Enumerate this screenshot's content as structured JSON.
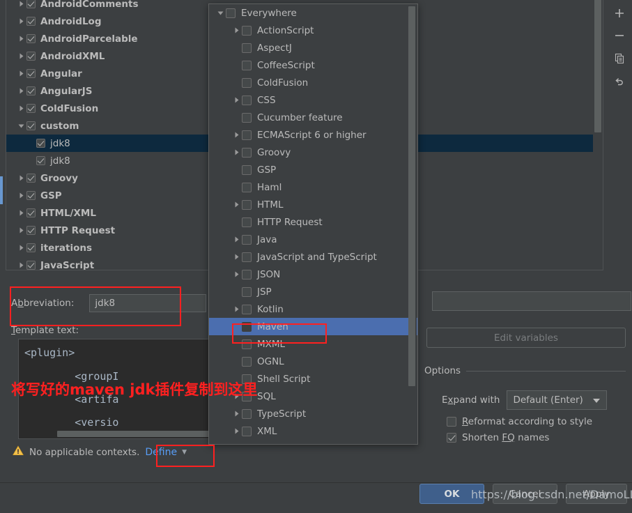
{
  "tree": {
    "scroll_thumb": true,
    "items": [
      {
        "label": "AndroidComments",
        "checked": true,
        "expandable": true,
        "expanded": false,
        "level": 0,
        "selected": false,
        "clipped": true
      },
      {
        "label": "AndroidLog",
        "checked": true,
        "expandable": true,
        "expanded": false,
        "level": 0,
        "selected": false
      },
      {
        "label": "AndroidParcelable",
        "checked": true,
        "expandable": true,
        "expanded": false,
        "level": 0,
        "selected": false
      },
      {
        "label": "AndroidXML",
        "checked": true,
        "expandable": true,
        "expanded": false,
        "level": 0,
        "selected": false
      },
      {
        "label": "Angular",
        "checked": true,
        "expandable": true,
        "expanded": false,
        "level": 0,
        "selected": false
      },
      {
        "label": "AngularJS",
        "checked": true,
        "expandable": true,
        "expanded": false,
        "level": 0,
        "selected": false
      },
      {
        "label": "ColdFusion",
        "checked": true,
        "expandable": true,
        "expanded": false,
        "level": 0,
        "selected": false
      },
      {
        "label": "custom",
        "checked": true,
        "expandable": true,
        "expanded": true,
        "level": 0,
        "selected": false
      },
      {
        "label": "jdk8",
        "checked": true,
        "expandable": false,
        "expanded": false,
        "level": 1,
        "selected": true
      },
      {
        "label": "jdk8",
        "checked": true,
        "expandable": false,
        "expanded": false,
        "level": 1,
        "selected": false
      },
      {
        "label": "Groovy",
        "checked": true,
        "expandable": true,
        "expanded": false,
        "level": 0,
        "selected": false
      },
      {
        "label": "GSP",
        "checked": true,
        "expandable": true,
        "expanded": false,
        "level": 0,
        "selected": false
      },
      {
        "label": "HTML/XML",
        "checked": true,
        "expandable": true,
        "expanded": false,
        "level": 0,
        "selected": false
      },
      {
        "label": "HTTP Request",
        "checked": true,
        "expandable": true,
        "expanded": false,
        "level": 0,
        "selected": false
      },
      {
        "label": "iterations",
        "checked": true,
        "expandable": true,
        "expanded": false,
        "level": 0,
        "selected": false
      },
      {
        "label": "JavaScript",
        "checked": true,
        "expandable": true,
        "expanded": false,
        "level": 0,
        "selected": false
      }
    ]
  },
  "rail": {
    "buttons": [
      {
        "icon": "plus-icon",
        "name": "add-template-button"
      },
      {
        "icon": "minus-icon",
        "name": "remove-template-button"
      },
      {
        "icon": "copy-icon",
        "name": "duplicate-template-button"
      },
      {
        "icon": "undo-icon",
        "name": "restore-defaults-button"
      }
    ]
  },
  "context_popup": {
    "items": [
      {
        "label": "Everywhere",
        "level": 0,
        "expandable": true,
        "expanded": true,
        "checked": false,
        "selected": false
      },
      {
        "label": "ActionScript",
        "level": 1,
        "expandable": true,
        "expanded": false,
        "checked": false,
        "selected": false
      },
      {
        "label": "AspectJ",
        "level": 1,
        "expandable": false,
        "expanded": false,
        "checked": false,
        "selected": false
      },
      {
        "label": "CoffeeScript",
        "level": 1,
        "expandable": false,
        "expanded": false,
        "checked": false,
        "selected": false
      },
      {
        "label": "ColdFusion",
        "level": 1,
        "expandable": false,
        "expanded": false,
        "checked": false,
        "selected": false
      },
      {
        "label": "CSS",
        "level": 1,
        "expandable": true,
        "expanded": false,
        "checked": false,
        "selected": false
      },
      {
        "label": "Cucumber feature",
        "level": 1,
        "expandable": false,
        "expanded": false,
        "checked": false,
        "selected": false
      },
      {
        "label": "ECMAScript 6 or higher",
        "level": 1,
        "expandable": true,
        "expanded": false,
        "checked": false,
        "selected": false
      },
      {
        "label": "Groovy",
        "level": 1,
        "expandable": true,
        "expanded": false,
        "checked": false,
        "selected": false
      },
      {
        "label": "GSP",
        "level": 1,
        "expandable": false,
        "expanded": false,
        "checked": false,
        "selected": false
      },
      {
        "label": "Haml",
        "level": 1,
        "expandable": false,
        "expanded": false,
        "checked": false,
        "selected": false
      },
      {
        "label": "HTML",
        "level": 1,
        "expandable": true,
        "expanded": false,
        "checked": false,
        "selected": false
      },
      {
        "label": "HTTP Request",
        "level": 1,
        "expandable": false,
        "expanded": false,
        "checked": false,
        "selected": false
      },
      {
        "label": "Java",
        "level": 1,
        "expandable": true,
        "expanded": false,
        "checked": false,
        "selected": false
      },
      {
        "label": "JavaScript and TypeScript",
        "level": 1,
        "expandable": true,
        "expanded": false,
        "checked": false,
        "selected": false
      },
      {
        "label": "JSON",
        "level": 1,
        "expandable": true,
        "expanded": false,
        "checked": false,
        "selected": false
      },
      {
        "label": "JSP",
        "level": 1,
        "expandable": false,
        "expanded": false,
        "checked": false,
        "selected": false
      },
      {
        "label": "Kotlin",
        "level": 1,
        "expandable": true,
        "expanded": false,
        "checked": false,
        "selected": false
      },
      {
        "label": "Maven",
        "level": 1,
        "expandable": false,
        "expanded": false,
        "checked": false,
        "selected": true
      },
      {
        "label": "MXML",
        "level": 1,
        "expandable": false,
        "expanded": false,
        "checked": false,
        "selected": false
      },
      {
        "label": "OGNL",
        "level": 1,
        "expandable": false,
        "expanded": false,
        "checked": false,
        "selected": false
      },
      {
        "label": "Shell Script",
        "level": 1,
        "expandable": false,
        "expanded": false,
        "checked": false,
        "selected": false
      },
      {
        "label": "SQL",
        "level": 1,
        "expandable": true,
        "expanded": false,
        "checked": false,
        "selected": false
      },
      {
        "label": "TypeScript",
        "level": 1,
        "expandable": true,
        "expanded": false,
        "checked": false,
        "selected": false
      },
      {
        "label": "XML",
        "level": 1,
        "expandable": true,
        "expanded": false,
        "checked": false,
        "selected": false
      }
    ]
  },
  "form": {
    "abbreviation_label": "Abbreviation:",
    "abbreviation_label_pre": "A",
    "abbreviation_label_mnemonic": "b",
    "abbreviation_label_post": "breviation:",
    "abbreviation_value": "jdk8",
    "description_value": "",
    "template_text_label": "Template text:",
    "template_text_label_mnemonic": "T",
    "template_text_label_post": "emplate text:",
    "editor_lines": [
      "<plugin>",
      "        <groupI",
      "        <artifa",
      "        <versio"
    ],
    "warning_text": "No applicable contexts.",
    "warning_icon": "warning-triangle-icon",
    "define_label": "Define",
    "define_caret": "▼"
  },
  "options": {
    "edit_variables_label": "Edit variables",
    "section_title": "Options",
    "expand_with_label": "Expand with",
    "expand_with_label_mnemonic": "x",
    "expand_with_value": "Default (Enter)",
    "checkboxes": [
      {
        "label": "Reformat according to style",
        "checked": false,
        "mnemonic": "R"
      },
      {
        "label": "Shorten FQ names",
        "checked": true,
        "mnemonic": "FQ"
      }
    ]
  },
  "footer": {
    "ok_label": "OK",
    "cancel_label": "Cancel",
    "apply_label": "Apply"
  },
  "annotations": {
    "note_text": "将写好的maven jdk插件复制到这里",
    "watermark": "https://blog.csdn.net/DamoLL",
    "highlight_color": "#ff2020"
  },
  "colors": {
    "background": "#3c3f41",
    "selection_tree": "#0d293e",
    "selection_popup": "#4b6eaf",
    "accent_link": "#589df6",
    "ok_button": "#3f5f8b",
    "editor_background": "#2b2b2b",
    "editor_text": "#a9b7c6"
  }
}
